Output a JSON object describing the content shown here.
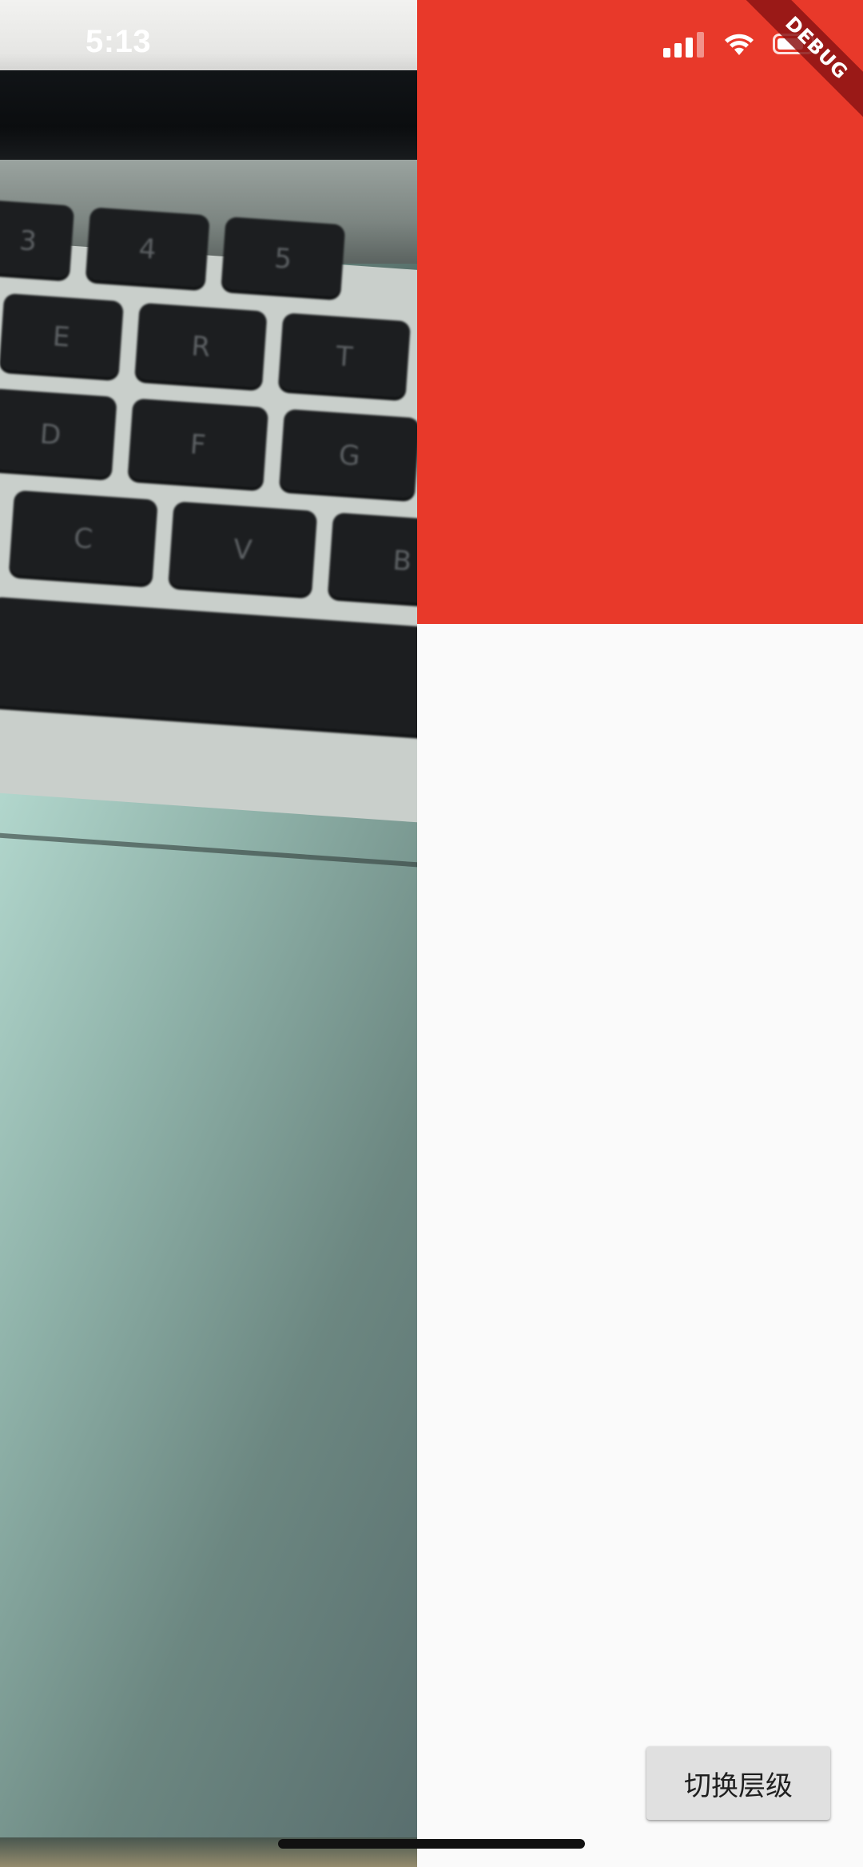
{
  "status_bar": {
    "time": "5:13",
    "signal_icon": "cellular-signal-icon",
    "wifi_icon": "wifi-icon",
    "battery_icon": "battery-icon"
  },
  "debug_banner": {
    "label": "DEBUG"
  },
  "photo": {
    "description_icon": "camera-photo-preview",
    "keys": [
      "3",
      "4",
      "5",
      "E",
      "R",
      "T",
      "D",
      "F",
      "G",
      "C",
      "V",
      "B"
    ]
  },
  "red_box": {
    "color": "#e8392a"
  },
  "toggle_button": {
    "label": "切换层级"
  }
}
